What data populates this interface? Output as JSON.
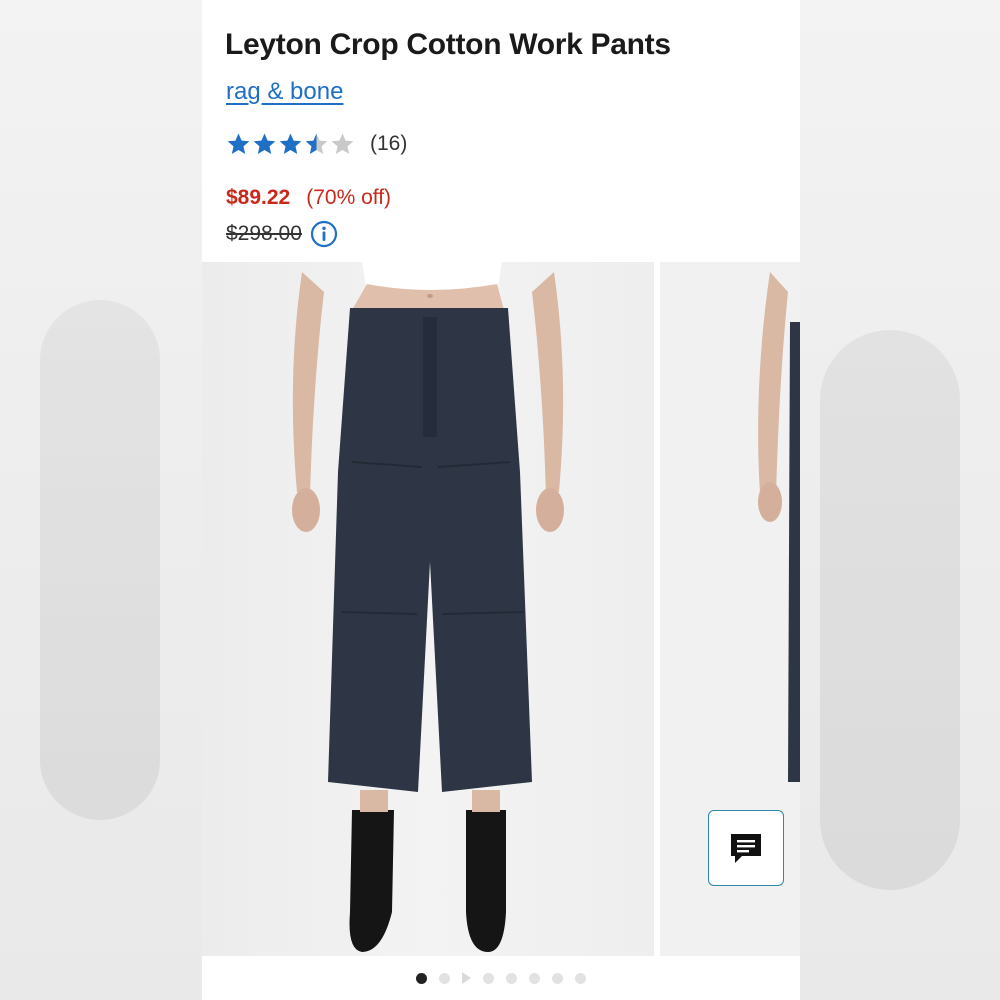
{
  "product": {
    "title": "Leyton Crop Cotton Work Pants",
    "brand": "rag & bone",
    "rating": 3.5,
    "review_count": "(16)",
    "sale_price": "$89.22",
    "discount": "(70% off)",
    "original_price": "$298.00"
  },
  "colors": {
    "star_filled": "#1f6fc5",
    "star_empty": "#c9c9c9",
    "sale": "#c8291b",
    "link": "#1f6fc5",
    "pants": "#2e3645"
  },
  "icons": {
    "info": "info-circle-icon",
    "chat": "chat-icon"
  },
  "gallery": {
    "image_count": 8,
    "active_index": 0,
    "video_index": 2
  }
}
